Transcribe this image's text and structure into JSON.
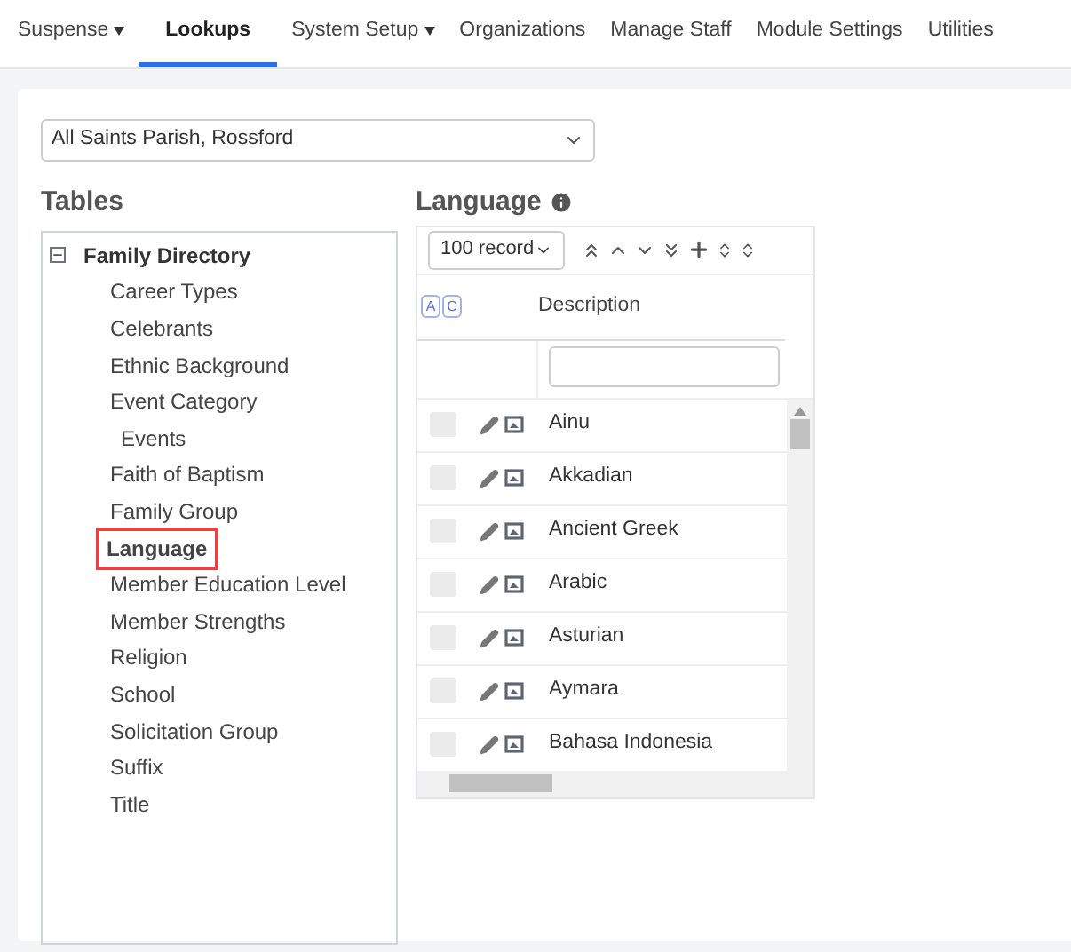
{
  "nav": [
    {
      "label": "Suspense",
      "dropdown": true,
      "selected": false
    },
    {
      "label": "Lookups",
      "dropdown": false,
      "selected": true
    },
    {
      "label": "System Setup",
      "dropdown": true,
      "selected": false
    },
    {
      "label": "Organizations",
      "dropdown": false,
      "selected": false
    },
    {
      "label": "Manage Staff",
      "dropdown": false,
      "selected": false
    },
    {
      "label": "Module Settings",
      "dropdown": false,
      "selected": false
    },
    {
      "label": "Utilities",
      "dropdown": false,
      "selected": false
    }
  ],
  "parish_select": {
    "value": "All Saints Parish, Rossford"
  },
  "tables": {
    "title": "Tables",
    "tree": [
      {
        "label": "Family Directory",
        "expanded": true,
        "children": [
          {
            "label": "Career Types",
            "selected": false
          },
          {
            "label": "Celebrants",
            "selected": false
          },
          {
            "label": "Ethnic Background",
            "selected": false
          },
          {
            "label": "Event Category",
            "selected": false,
            "children": [
              {
                "label": "Events",
                "selected": false
              }
            ]
          },
          {
            "label": "Faith of Baptism",
            "selected": false
          },
          {
            "label": "Family Group",
            "selected": false
          },
          {
            "label": "Language",
            "selected": true
          },
          {
            "label": "Member Education Level",
            "selected": false
          },
          {
            "label": "Member Strengths",
            "selected": false
          },
          {
            "label": "Religion",
            "selected": false
          },
          {
            "label": "School",
            "selected": false
          },
          {
            "label": "Solicitation Group",
            "selected": false
          },
          {
            "label": "Suffix",
            "selected": false
          },
          {
            "label": "Title",
            "selected": false
          }
        ]
      }
    ]
  },
  "grid": {
    "title": "Language",
    "page_size": "100 record",
    "header_badges": [
      "A",
      "C"
    ],
    "column": "Description",
    "rows": [
      {
        "description": "Ainu",
        "checked": false
      },
      {
        "description": "Akkadian",
        "checked": false
      },
      {
        "description": "Ancient Greek",
        "checked": false
      },
      {
        "description": "Arabic",
        "checked": false
      },
      {
        "description": "Asturian",
        "checked": false
      },
      {
        "description": "Aymara",
        "checked": false
      },
      {
        "description": "Bahasa Indonesia",
        "checked": false
      }
    ]
  }
}
